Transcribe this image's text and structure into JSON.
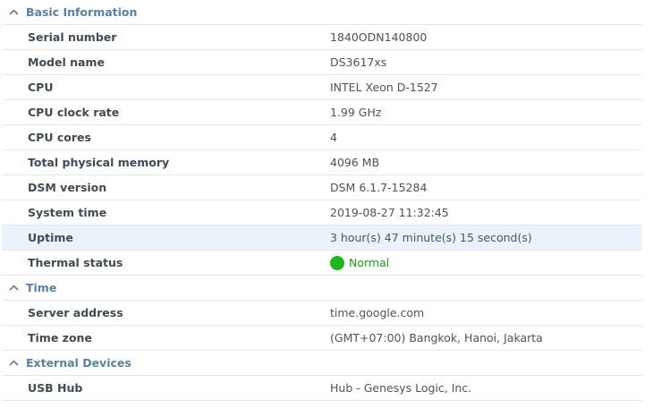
{
  "sections": [
    {
      "title": "Basic Information",
      "rows": [
        {
          "label": "Serial number",
          "value": "1840ODN140800"
        },
        {
          "label": "Model name",
          "value": "DS3617xs"
        },
        {
          "label": "CPU",
          "value": "INTEL Xeon D-1527"
        },
        {
          "label": "CPU clock rate",
          "value": "1.99 GHz"
        },
        {
          "label": "CPU cores",
          "value": "4"
        },
        {
          "label": "Total physical memory",
          "value": "4096 MB"
        },
        {
          "label": "DSM version",
          "value": "DSM 6.1.7-15284"
        },
        {
          "label": "System time",
          "value": "2019-08-27 11:32:45"
        },
        {
          "label": "Uptime",
          "value": "3 hour(s) 47 minute(s) 15 second(s)"
        },
        {
          "label": "Thermal status",
          "value": "Normal",
          "status_color": "#1eb71e"
        }
      ]
    },
    {
      "title": "Time",
      "rows": [
        {
          "label": "Server address",
          "value": "time.google.com"
        },
        {
          "label": "Time zone",
          "value": "(GMT+07:00) Bangkok, Hanoi, Jakarta"
        }
      ]
    },
    {
      "title": "External Devices",
      "rows": [
        {
          "label": "USB Hub",
          "value": "Hub - Genesys Logic, Inc."
        }
      ]
    }
  ],
  "icons": {
    "section_toggle": "chevron-up-icon",
    "status": "status-dot-icon"
  }
}
